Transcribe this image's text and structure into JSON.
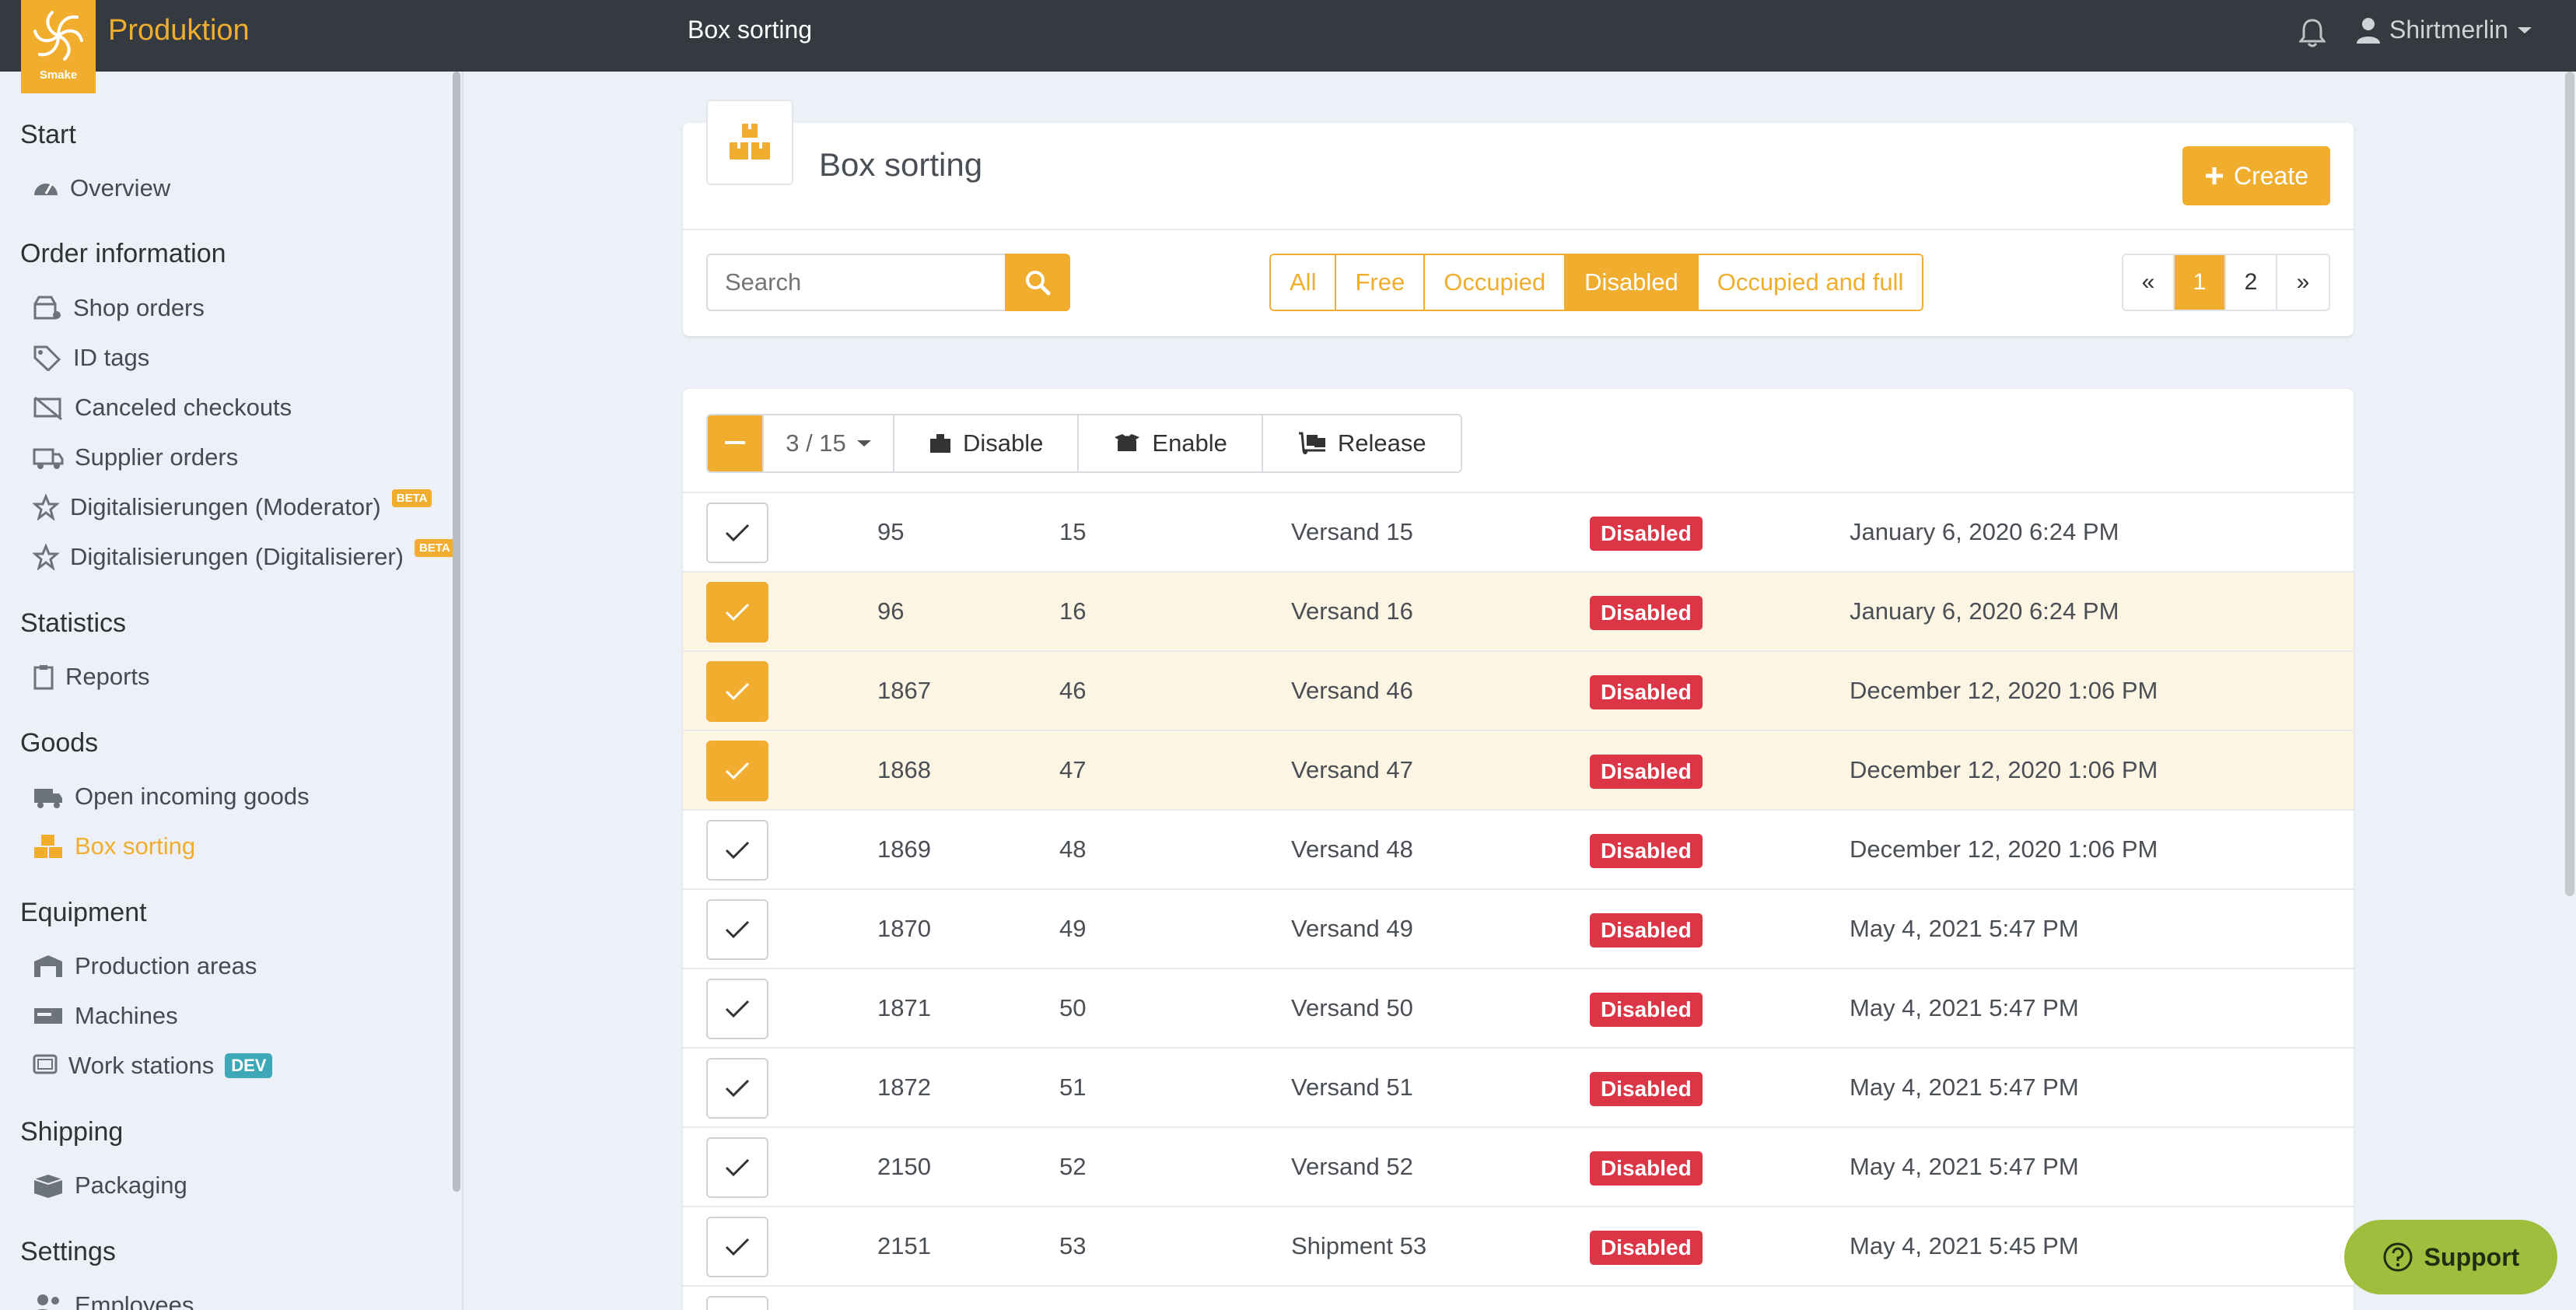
{
  "app": {
    "brand": "Produktion",
    "logo_text": "Smake",
    "page_title": "Box sorting",
    "user": "Shirtmerlin"
  },
  "sidebar": {
    "sections": [
      {
        "title": "Start",
        "items": [
          {
            "label": "Overview",
            "icon": "dashboard-icon"
          }
        ]
      },
      {
        "title": "Order information",
        "items": [
          {
            "label": "Shop orders",
            "icon": "shop-icon"
          },
          {
            "label": "ID tags",
            "icon": "tags-icon"
          },
          {
            "label": "Canceled checkouts",
            "icon": "canceled-checkout-icon"
          },
          {
            "label": "Supplier orders",
            "icon": "truck-icon"
          },
          {
            "label": "Digitalisierungen (Moderator)",
            "icon": "digitize-icon",
            "badge": "BETA"
          },
          {
            "label": "Digitalisierungen (Digitalisierer)",
            "icon": "digitize-icon",
            "badge": "BETA"
          }
        ]
      },
      {
        "title": "Statistics",
        "items": [
          {
            "label": "Reports",
            "icon": "clipboard-icon"
          }
        ]
      },
      {
        "title": "Goods",
        "items": [
          {
            "label": "Open incoming goods",
            "icon": "incoming-truck-icon"
          },
          {
            "label": "Box sorting",
            "icon": "boxes-icon",
            "active": true
          }
        ]
      },
      {
        "title": "Equipment",
        "items": [
          {
            "label": "Production areas",
            "icon": "warehouse-icon"
          },
          {
            "label": "Machines",
            "icon": "machine-icon"
          },
          {
            "label": "Work stations",
            "icon": "workstation-icon",
            "badge": "DEV"
          }
        ]
      },
      {
        "title": "Shipping",
        "items": [
          {
            "label": "Packaging",
            "icon": "packaging-icon"
          }
        ]
      },
      {
        "title": "Settings",
        "items": [
          {
            "label": "Employees",
            "icon": "users-icon"
          }
        ]
      }
    ]
  },
  "header": {
    "title": "Box sorting",
    "create_label": "Create",
    "search_placeholder": "Search",
    "filters": [
      {
        "label": "All",
        "active": false
      },
      {
        "label": "Free",
        "active": false
      },
      {
        "label": "Occupied",
        "active": false
      },
      {
        "label": "Disabled",
        "active": true
      },
      {
        "label": "Occupied and full",
        "active": false
      }
    ],
    "pagination": {
      "prev": "«",
      "pages": [
        "1",
        "2"
      ],
      "current": "1",
      "next": "»"
    }
  },
  "bulk": {
    "selection_count": "3 / 15",
    "disable_label": "Disable",
    "enable_label": "Enable",
    "release_label": "Release"
  },
  "rows": [
    {
      "id": "95",
      "number": "15",
      "name": "Versand 15",
      "status": "Disabled",
      "date": "January 6, 2020 6:24 PM",
      "checked": false
    },
    {
      "id": "96",
      "number": "16",
      "name": "Versand 16",
      "status": "Disabled",
      "date": "January 6, 2020 6:24 PM",
      "checked": true
    },
    {
      "id": "1867",
      "number": "46",
      "name": "Versand 46",
      "status": "Disabled",
      "date": "December 12, 2020 1:06 PM",
      "checked": true
    },
    {
      "id": "1868",
      "number": "47",
      "name": "Versand 47",
      "status": "Disabled",
      "date": "December 12, 2020 1:06 PM",
      "checked": true
    },
    {
      "id": "1869",
      "number": "48",
      "name": "Versand 48",
      "status": "Disabled",
      "date": "December 12, 2020 1:06 PM",
      "checked": false
    },
    {
      "id": "1870",
      "number": "49",
      "name": "Versand 49",
      "status": "Disabled",
      "date": "May 4, 2021 5:47 PM",
      "checked": false
    },
    {
      "id": "1871",
      "number": "50",
      "name": "Versand 50",
      "status": "Disabled",
      "date": "May 4, 2021 5:47 PM",
      "checked": false
    },
    {
      "id": "1872",
      "number": "51",
      "name": "Versand 51",
      "status": "Disabled",
      "date": "May 4, 2021 5:47 PM",
      "checked": false
    },
    {
      "id": "2150",
      "number": "52",
      "name": "Versand 52",
      "status": "Disabled",
      "date": "May 4, 2021 5:47 PM",
      "checked": false
    },
    {
      "id": "2151",
      "number": "53",
      "name": "Shipment 53",
      "status": "Disabled",
      "date": "May 4, 2021 5:45 PM",
      "checked": false
    }
  ],
  "support_label": "Support",
  "colors": {
    "accent": "#f0ad2e",
    "topbar": "#343a40",
    "danger": "#dc3545",
    "support": "#9fbe3d",
    "dev": "#3fa8b8"
  }
}
